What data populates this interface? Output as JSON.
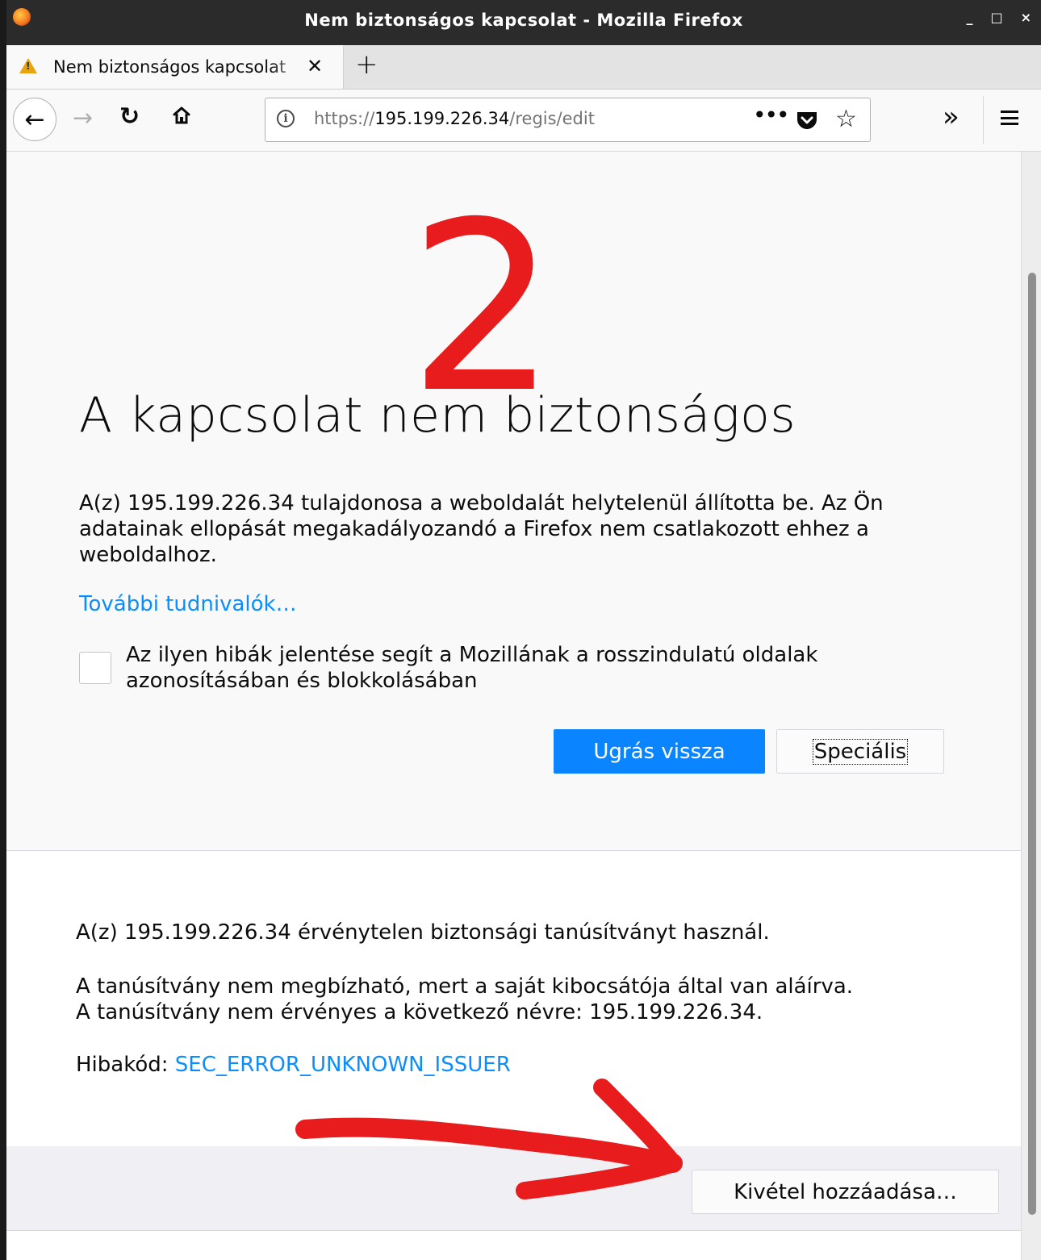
{
  "window": {
    "title": "Nem biztonságos kapcsolat - Mozilla Firefox",
    "controls": {
      "minimize": "_",
      "maximize": "□",
      "close": "×"
    }
  },
  "tabs": [
    {
      "label": "Nem biztonságos kapcsolat",
      "close": "✕"
    }
  ],
  "newtab_label": "+",
  "toolbar": {
    "url": {
      "scheme": "https://",
      "host": "195.199.226.34",
      "path": "/regis/edit"
    },
    "more_label": "•••",
    "overflow_label": "»"
  },
  "annotation": {
    "number": "2",
    "color": "#e81c1c"
  },
  "error_page": {
    "title": "A kapcsolat nem biztonságos",
    "description": "A(z) 195.199.226.34 tulajdonosa a weboldalát helytelenül állította be. Az Ön adatainak ellopását megakadályozandó a Firefox nem csatlakozott ehhez a weboldalhoz.",
    "learn_more": "További tudnivalók…",
    "report_checkbox_label": "Az ilyen hibák jelentése segít a Mozillának a rosszindulatú oldalak azonosításában és blokkolásában",
    "go_back_button": "Ugrás vissza",
    "advanced_button": "Speciális",
    "advanced": {
      "line1": "A(z) 195.199.226.34 érvénytelen biztonsági tanúsítványt használ.",
      "line2": "A tanúsítvány nem megbízható, mert a saját kibocsátója által van aláírva.",
      "line3": "A tanúsítvány nem érvényes a következő névre: 195.199.226.34.",
      "error_code_label": "Hibakód: ",
      "error_code": "SEC_ERROR_UNKNOWN_ISSUER",
      "add_exception_button": "Kivétel hozzáadása…"
    }
  },
  "colors": {
    "accent": "#0a84ff",
    "link": "#0a8dff",
    "warning": "#e8a40e"
  }
}
